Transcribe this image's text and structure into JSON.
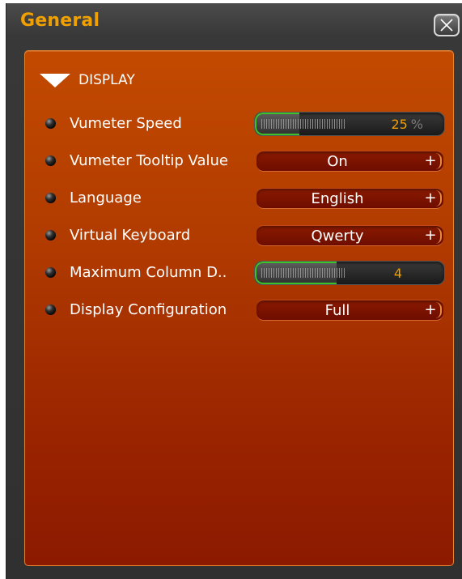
{
  "window": {
    "title": "General",
    "close_icon": "close-x-icon"
  },
  "section": {
    "label": "DISPLAY",
    "state": "expanded",
    "icon": "triangle-down-icon"
  },
  "settings": [
    {
      "label": "Vumeter Speed",
      "type": "slider",
      "value": "25",
      "unit": "%",
      "level": 0.25
    },
    {
      "label": "Vumeter Tooltip Value",
      "type": "selector",
      "value": "On",
      "button": "+"
    },
    {
      "label": "Language",
      "type": "selector",
      "value": "English",
      "button": "+"
    },
    {
      "label": "Virtual Keyboard",
      "type": "selector",
      "value": "Qwerty",
      "button": "+"
    },
    {
      "label": "Maximum Column D..",
      "type": "slider",
      "value": "4",
      "unit": "",
      "level": 0.43
    },
    {
      "label": "Display Configuration",
      "type": "selector",
      "value": "Full",
      "button": "+"
    }
  ],
  "colors": {
    "title": "#f0a000",
    "panel_top": "#c24a00",
    "panel_bottom": "#8c1a00",
    "slider_accent": "#3ec22c",
    "slider_value": "#f0a000"
  }
}
